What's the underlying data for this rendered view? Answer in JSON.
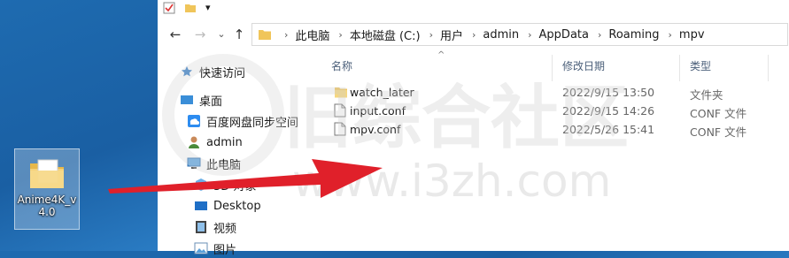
{
  "desktop": {
    "icon_label": "Anime4K_v4.0"
  },
  "qat": {
    "dropdown": "▾"
  },
  "nav_buttons": {
    "back": "←",
    "forward": "→",
    "recent": "⌄",
    "up": "↑"
  },
  "breadcrumbs": [
    "此电脑",
    "本地磁盘 (C:)",
    "用户",
    "admin",
    "AppData",
    "Roaming",
    "mpv"
  ],
  "sidebar": {
    "items": [
      {
        "label": "快速访问",
        "icon": "star-icon"
      },
      {
        "label": "桌面",
        "icon": "desktop-icon"
      },
      {
        "label": "百度网盘同步空间",
        "icon": "cloud-sync-icon"
      },
      {
        "label": "admin",
        "icon": "user-icon"
      },
      {
        "label": "此电脑",
        "icon": "computer-icon"
      },
      {
        "label": "3D 对象",
        "icon": "3d-objects-icon"
      },
      {
        "label": "Desktop",
        "icon": "desktop-icon"
      },
      {
        "label": "视频",
        "icon": "video-icon"
      },
      {
        "label": "图片",
        "icon": "pictures-icon"
      }
    ]
  },
  "columns": {
    "name": "名称",
    "date": "修改日期",
    "type": "类型"
  },
  "files": [
    {
      "name": "watch_later",
      "date": "2022/9/15 13:50",
      "type": "文件夹",
      "icon": "folder-icon"
    },
    {
      "name": "input.conf",
      "date": "2022/9/15 14:26",
      "type": "CONF 文件",
      "icon": "file-icon"
    },
    {
      "name": "mpv.conf",
      "date": "2022/5/26 15:41",
      "type": "CONF 文件",
      "icon": "file-icon"
    }
  ],
  "watermark": {
    "site": "www.i3zh.com",
    "name": "旧综合社区"
  },
  "colors": {
    "arrow": "#e0202a",
    "folder": "#f0c55a",
    "desktop_bg": "#1e6bb0"
  }
}
